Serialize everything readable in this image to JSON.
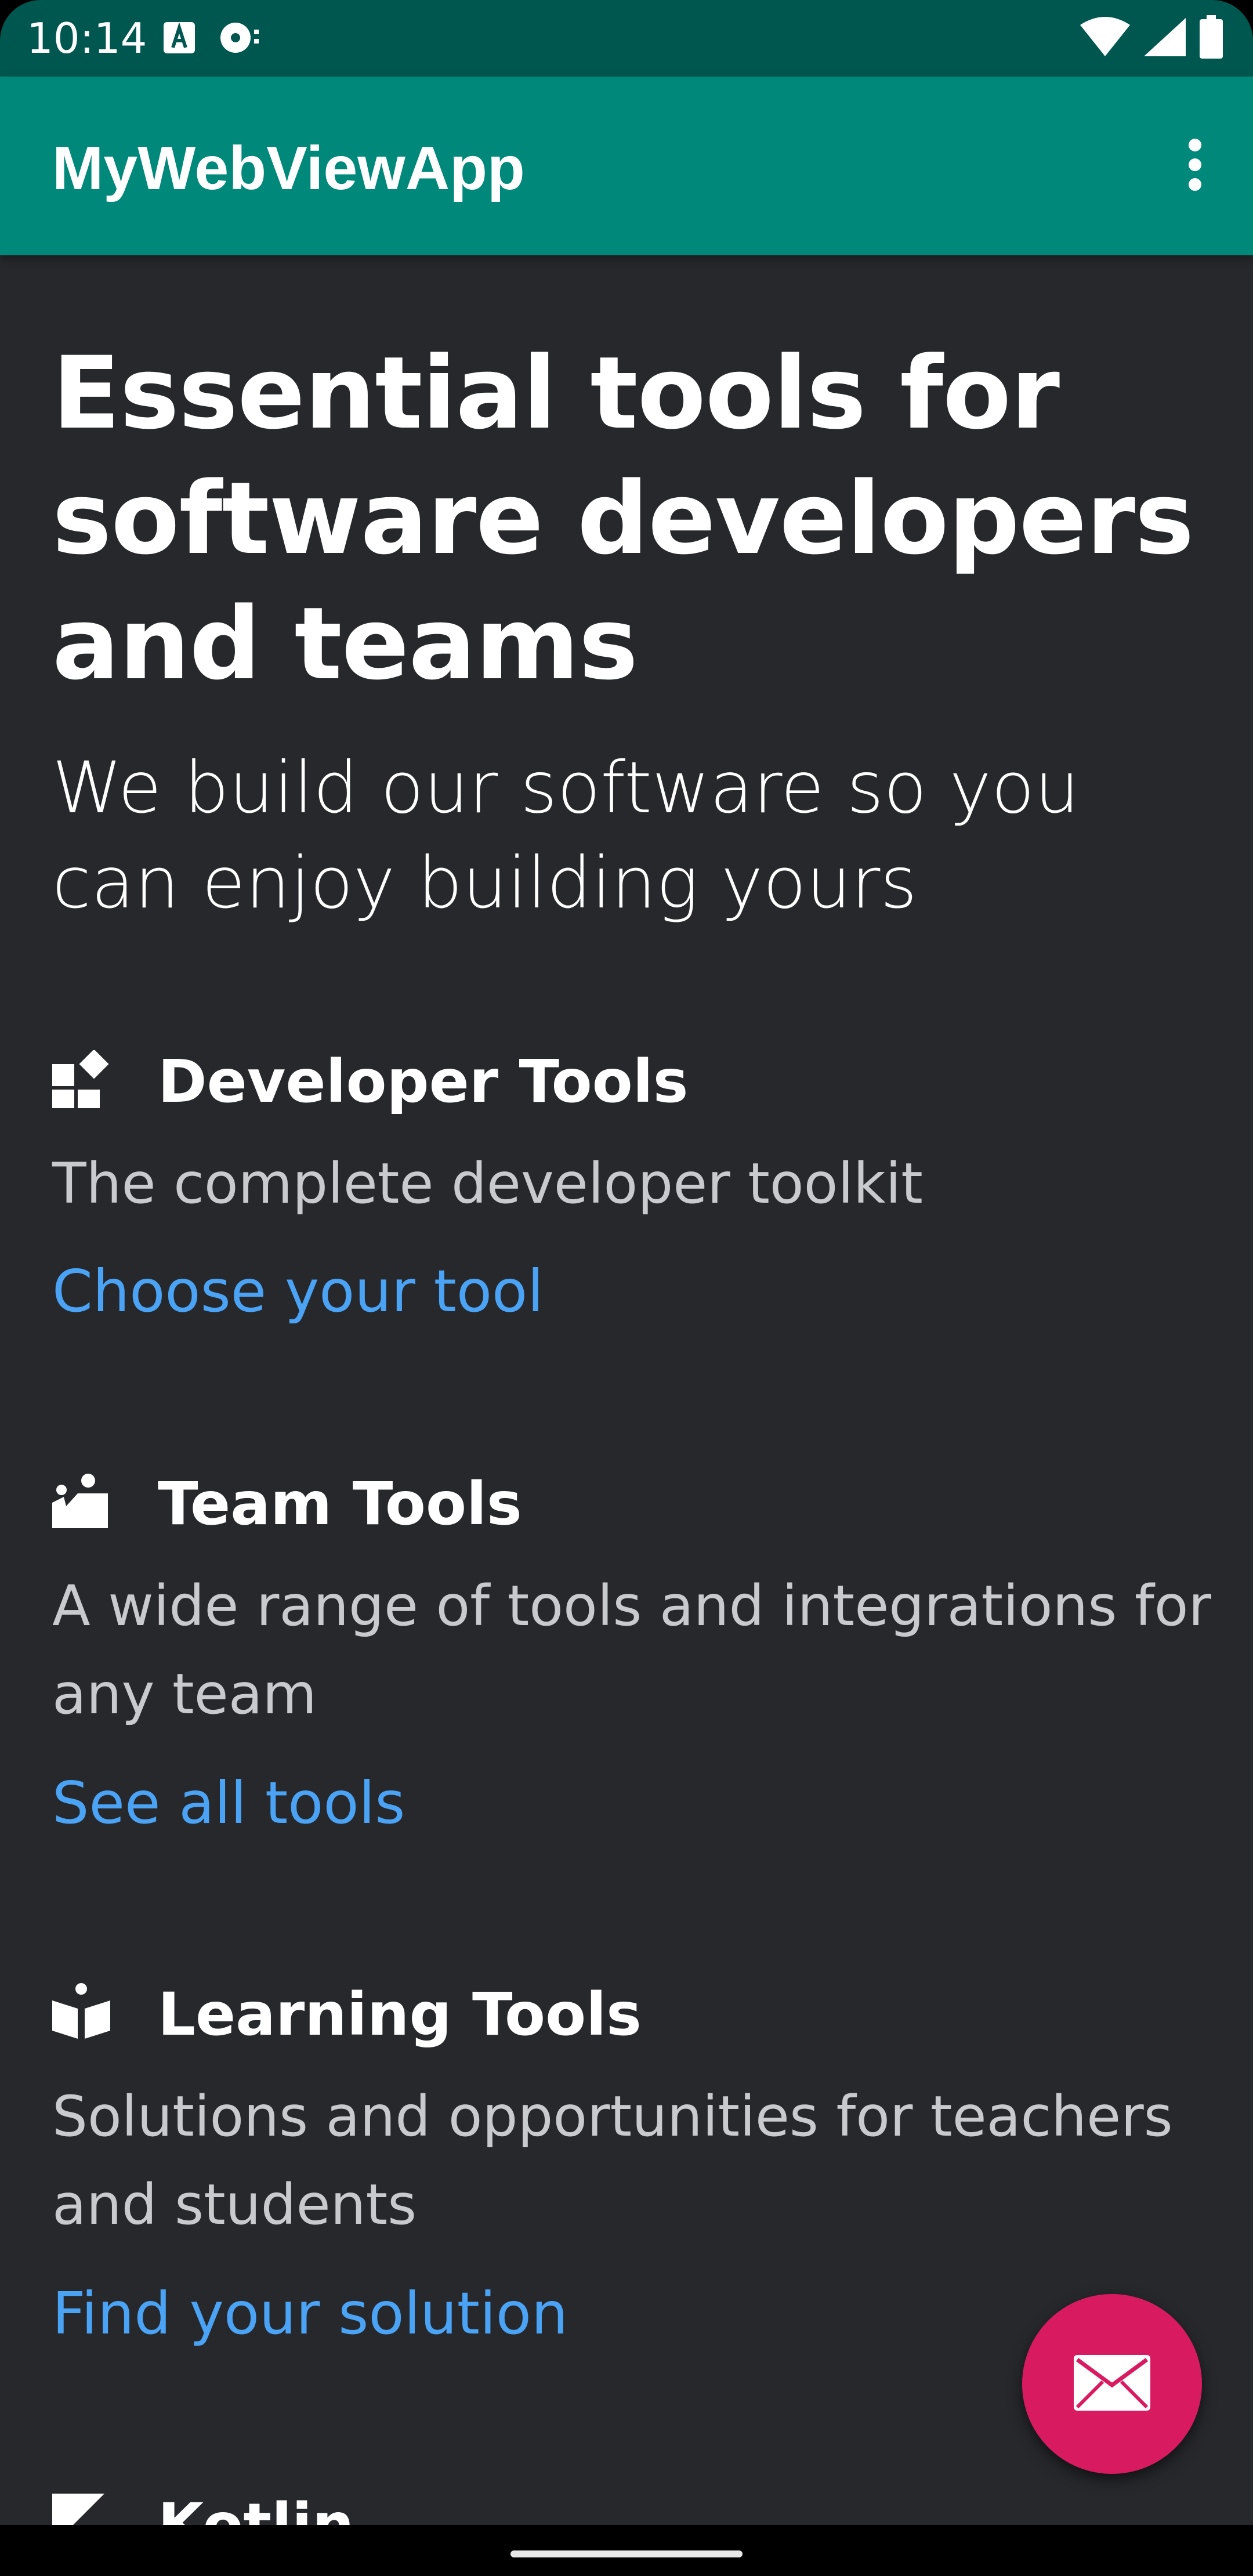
{
  "status_bar": {
    "time": "10:14",
    "icons_left": [
      "keyboard-a-icon",
      "media-icon"
    ],
    "icons_right": [
      "wifi-icon",
      "signal-icon",
      "battery-icon"
    ]
  },
  "app_bar": {
    "title": "MyWebViewApp",
    "menu_icon": "more-vert-icon"
  },
  "hero": {
    "title": "Essential tools for software developers and teams",
    "subtitle": "We build our software so you can enjoy building yours"
  },
  "sections": [
    {
      "icon": "developer-tools-icon",
      "title": "Developer Tools",
      "description": "The complete developer toolkit",
      "link": "Choose your tool"
    },
    {
      "icon": "team-tools-icon",
      "title": "Team Tools",
      "description": "A wide range of tools and integrations for any team",
      "link": "See all tools"
    },
    {
      "icon": "learning-tools-icon",
      "title": "Learning Tools",
      "description": "Solutions and opportunities for teachers and students",
      "link": "Find your solution"
    },
    {
      "icon": "kotlin-icon",
      "title": "Kotlin"
    }
  ],
  "fab": {
    "icon": "mail-icon"
  },
  "colors": {
    "status_bar": "#00574f",
    "app_bar": "#00897b",
    "background": "#27282c",
    "link": "#4aa3f5",
    "fab": "#d81b60"
  }
}
